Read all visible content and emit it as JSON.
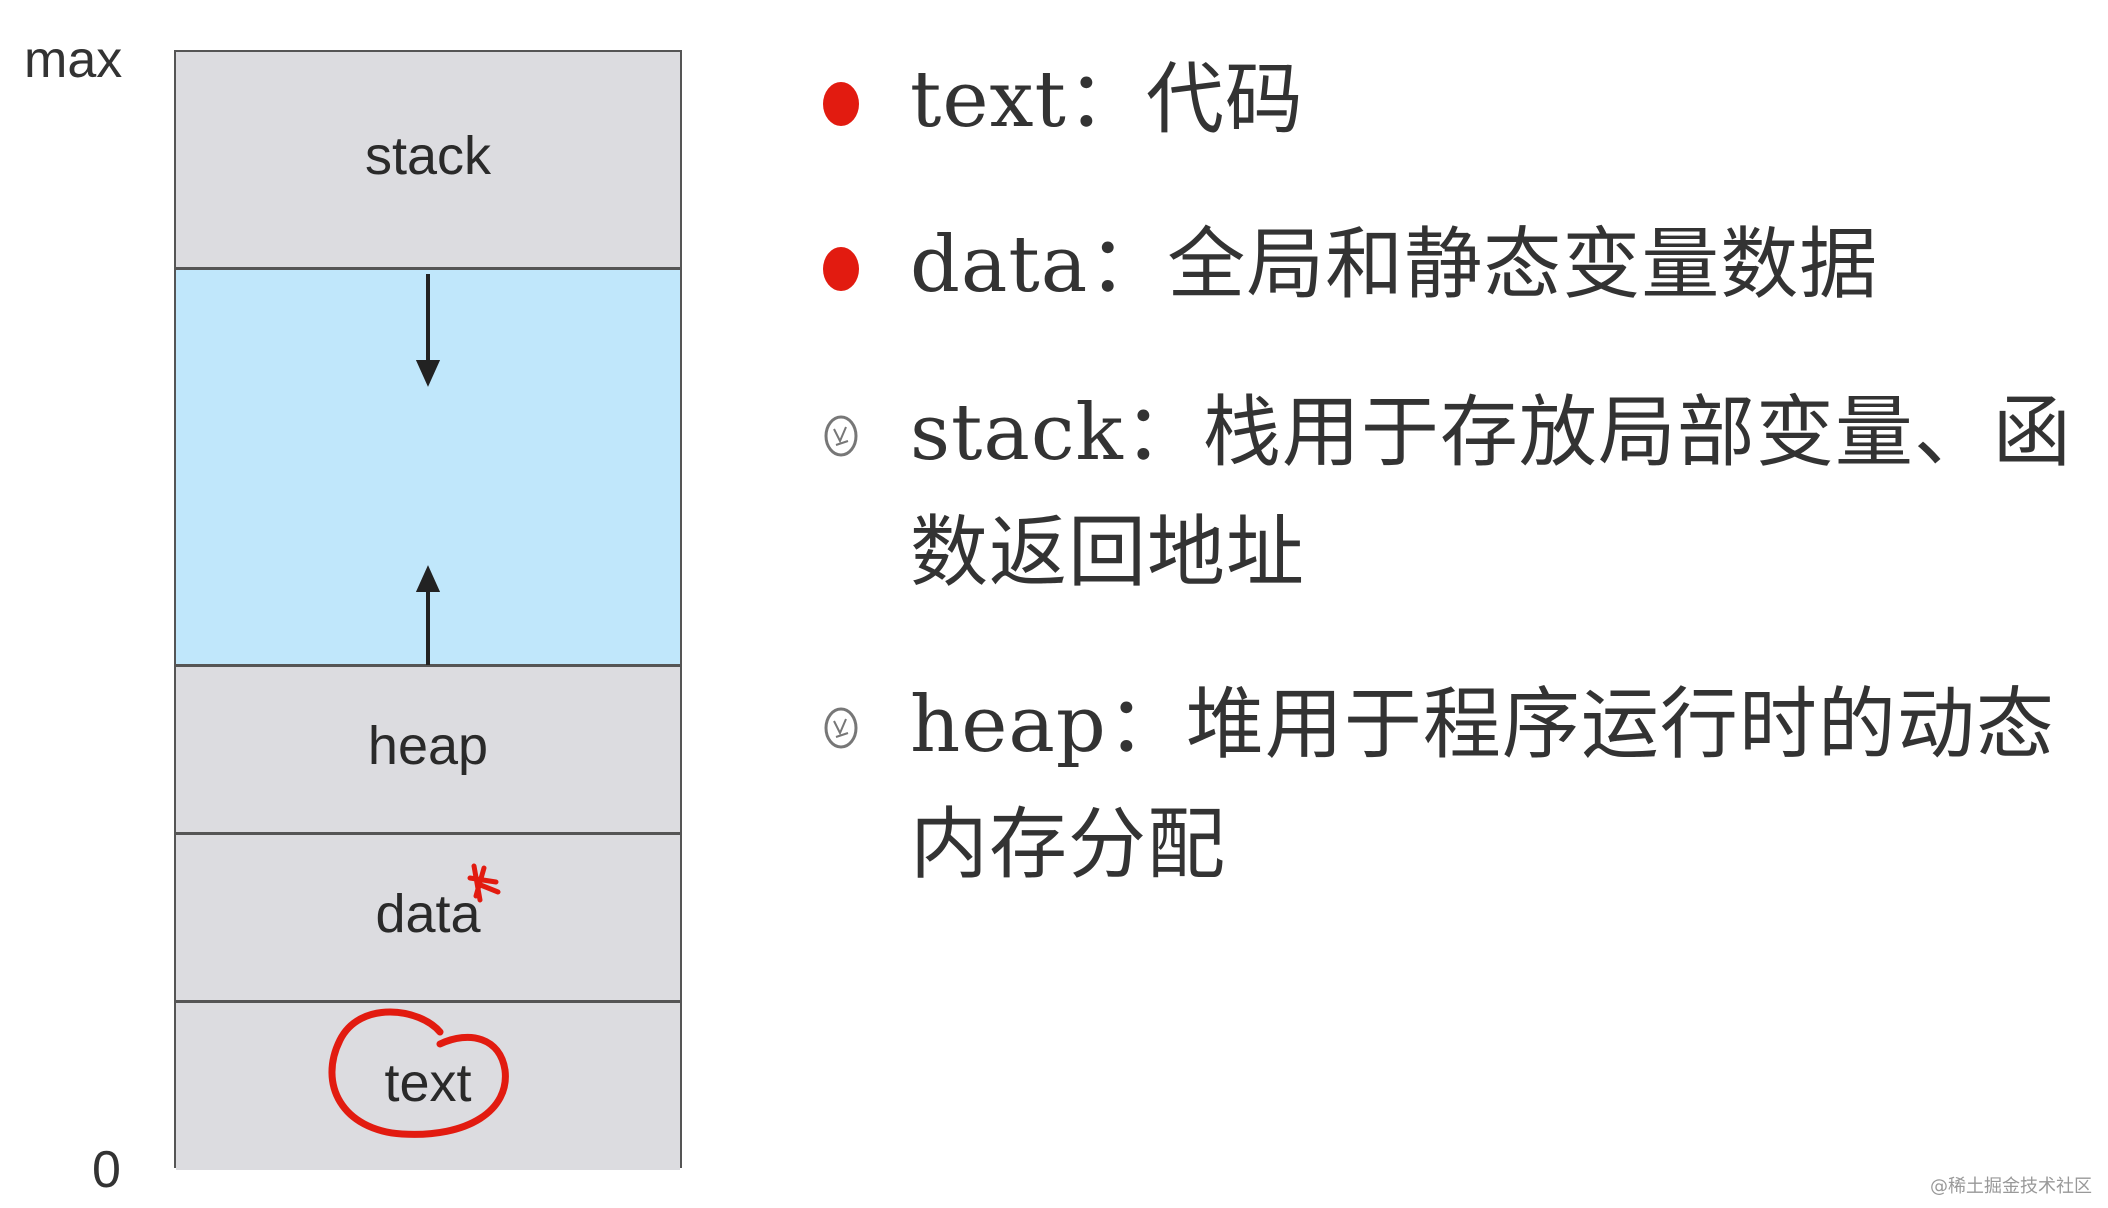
{
  "axis": {
    "top_label": "max",
    "bottom_label": "0"
  },
  "segments": {
    "stack": "stack",
    "heap": "heap",
    "data": "data",
    "text": "text"
  },
  "bullets": [
    {
      "text": "text：代码",
      "marker": "red-dot"
    },
    {
      "text": "data：全局和静态变量数据",
      "marker": "red-dot"
    },
    {
      "text": "stack：栈用于存放局部变量、函数返回地址",
      "marker": "hollow-bullet"
    },
    {
      "text": "heap：堆用于程序运行时的动态内存分配",
      "marker": "hollow-bullet"
    }
  ],
  "watermark": "@稀土掘金技术社区",
  "colors": {
    "segment_gray": "#dcdce0",
    "free_space_blue": "#c0e7fb",
    "annotation_red": "#e21b10"
  }
}
